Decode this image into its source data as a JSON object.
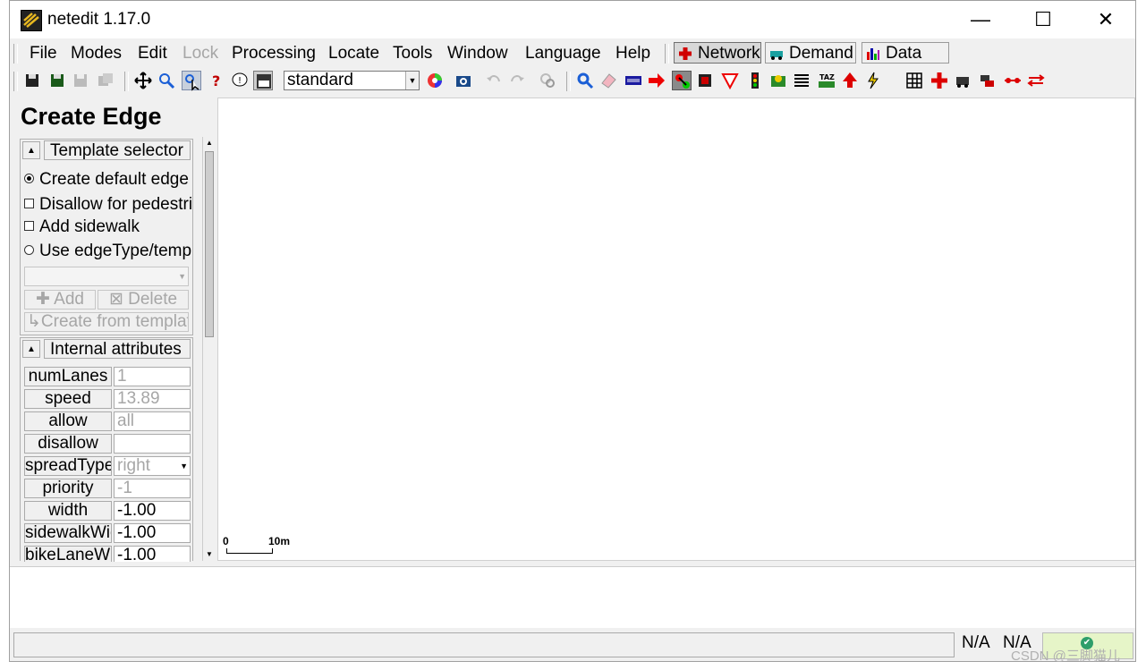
{
  "window": {
    "title": "netedit 1.17.0",
    "controls": {
      "minimize": "—",
      "maximize": "☐",
      "close": "✕"
    }
  },
  "menubar": {
    "items": [
      {
        "label": "File",
        "enabled": true
      },
      {
        "label": "Modes",
        "enabled": true
      },
      {
        "label": "Edit",
        "enabled": true
      },
      {
        "label": "Lock",
        "enabled": false
      },
      {
        "label": "Processing",
        "enabled": true
      },
      {
        "label": "Locate",
        "enabled": true
      },
      {
        "label": "Tools",
        "enabled": true
      },
      {
        "label": "Window",
        "enabled": true
      },
      {
        "label": "Language",
        "enabled": true
      },
      {
        "label": "Help",
        "enabled": true
      }
    ],
    "modes": [
      {
        "label": "Network",
        "active": true,
        "icon": "network-icon"
      },
      {
        "label": "Demand",
        "active": false,
        "icon": "demand-icon"
      },
      {
        "label": "Data",
        "active": false,
        "icon": "data-icon"
      }
    ]
  },
  "toolbar": {
    "view_scheme": "standard"
  },
  "sidebar": {
    "frame_title": "Create Edge",
    "template_selector": {
      "title": "Template selector",
      "collapse_symbol": "▲",
      "options": [
        {
          "label": "Create default edge",
          "type": "radio",
          "checked": true
        },
        {
          "label": "Disallow for pedestrians",
          "type": "checkbox",
          "checked": false
        },
        {
          "label": "Add sidewalk",
          "type": "checkbox",
          "checked": false
        },
        {
          "label": "Use edgeType/template",
          "type": "radio",
          "checked": false
        }
      ],
      "add_label": "Add",
      "delete_label": "Delete",
      "create_from_template_label": "Create from template"
    },
    "internal_attributes": {
      "title": "Internal attributes",
      "collapse_symbol": "▲",
      "rows": [
        {
          "name": "numLanes",
          "value": "1",
          "readonly": true
        },
        {
          "name": "speed",
          "value": "13.89",
          "readonly": true
        },
        {
          "name": "allow",
          "value": "all",
          "readonly": true
        },
        {
          "name": "disallow",
          "value": "",
          "readonly": false
        },
        {
          "name": "spreadType",
          "value": "right",
          "readonly": true,
          "dropdown": true
        },
        {
          "name": "priority",
          "value": "-1",
          "readonly": true
        },
        {
          "name": "width",
          "value": "-1.00",
          "readonly": false
        },
        {
          "name": "sidewalkWidth",
          "value": "-1.00",
          "readonly": false
        },
        {
          "name": "bikeLaneWidth",
          "value": "-1.00",
          "readonly": false
        }
      ]
    }
  },
  "canvas": {
    "scale_start": "0",
    "scale_end": "10m"
  },
  "statusbar": {
    "coord_x": "N/A",
    "coord_y": "N/A"
  },
  "watermark": "CSDN @三脚猫儿",
  "colors": {
    "window_bg": "#f0f0f0",
    "canvas_bg": "#ffffff",
    "disabled_text": "#a6a6a6",
    "status_ok_bg": "#e6f5c8"
  }
}
